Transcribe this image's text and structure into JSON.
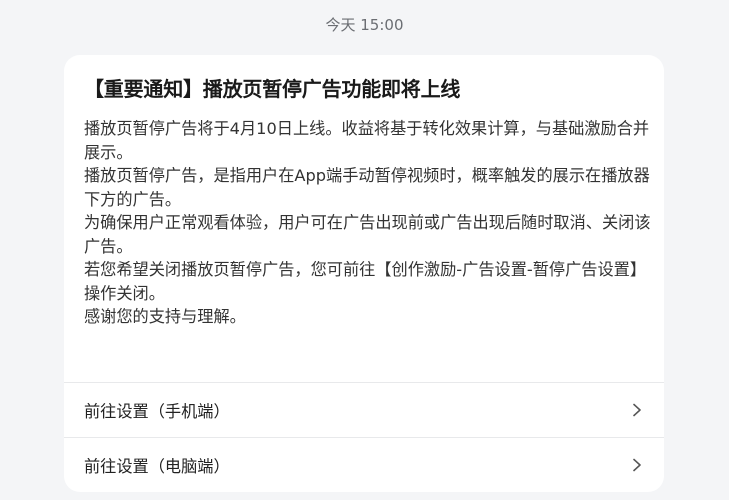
{
  "timestamp": "今天 15:00",
  "notice": {
    "title": "【重要通知】播放页暂停广告功能即将上线",
    "paragraphs": [
      "播放页暂停广告将于4月10日上线。收益将基于转化效果计算，与基础激励合并展示。",
      "播放页暂停广告，是指用户在App端手动暂停视频时，概率触发的展示在播放器下方的广告。",
      "为确保用户正常观看体验，用户可在广告出现前或广告出现后随时取消、关闭该广告。",
      "若您希望关闭播放页暂停广告，您可前往【创作激励-广告设置-暂停广告设置】操作关闭。",
      "感谢您的支持与理解。"
    ]
  },
  "actions": [
    {
      "label": "前往设置（手机端）",
      "icon": "chevron-right-icon"
    },
    {
      "label": "前往设置（电脑端）",
      "icon": "chevron-right-icon"
    }
  ]
}
